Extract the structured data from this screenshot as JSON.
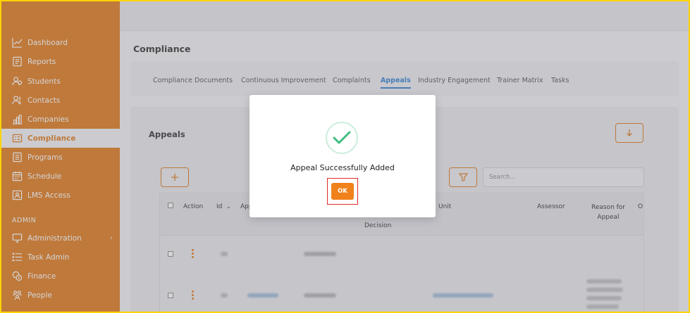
{
  "sidebar": {
    "items": [
      {
        "label": "Dashboard",
        "icon": "chart-line-icon"
      },
      {
        "label": "Reports",
        "icon": "report-icon"
      },
      {
        "label": "Students",
        "icon": "students-icon"
      },
      {
        "label": "Contacts",
        "icon": "contacts-icon"
      },
      {
        "label": "Companies",
        "icon": "companies-icon"
      },
      {
        "label": "Compliance",
        "icon": "compliance-icon",
        "active": true
      },
      {
        "label": "Programs",
        "icon": "programs-icon"
      },
      {
        "label": "Schedule",
        "icon": "calendar-icon"
      },
      {
        "label": "LMS Access",
        "icon": "lms-icon"
      }
    ],
    "admin_label": "ADMIN",
    "admin_items": [
      {
        "label": "Administration",
        "icon": "monitor-icon"
      },
      {
        "label": "Task Admin",
        "icon": "list-icon"
      },
      {
        "label": "Finance",
        "icon": "finance-icon"
      },
      {
        "label": "People",
        "icon": "people-icon"
      }
    ]
  },
  "page": {
    "title": "Compliance",
    "tabs": [
      "Compliance Documents",
      "Continuous Improvement",
      "Complaints",
      "Appeals",
      "Industry Engagement",
      "Trainer Matrix",
      "Tasks"
    ],
    "active_tab": "Appeals"
  },
  "card": {
    "title": "Appeals",
    "search_placeholder": "Search...",
    "columns": [
      "Action",
      "Id",
      "App",
      "Decision",
      "Unit",
      "Assessor",
      "Reason for Appeal",
      "O"
    ]
  },
  "modal": {
    "message": "Appeal Successfully Added",
    "ok_label": "OK"
  },
  "colors": {
    "brand": "#e07a1b",
    "accent_blue": "#2f7fd1",
    "success": "#3fbf7f",
    "highlight": "#e02a2a"
  }
}
